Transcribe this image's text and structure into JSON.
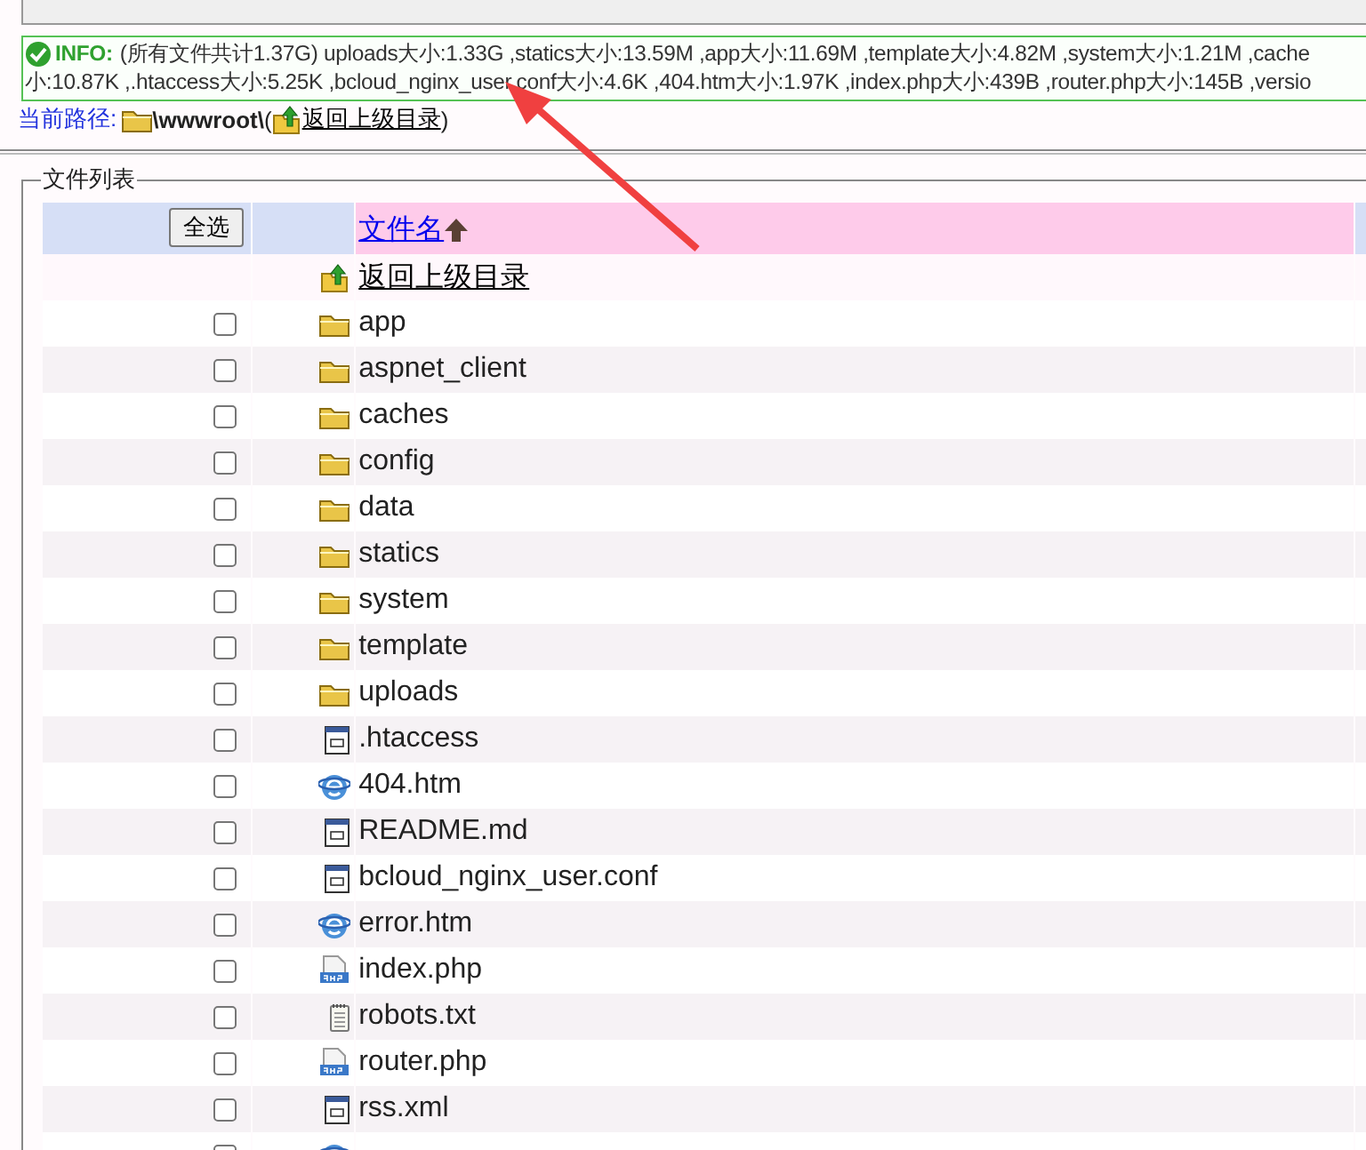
{
  "info": {
    "label": "INFO:",
    "lines": [
      "(所有文件共计1.37G) uploads大小:1.33G ,statics大小:13.59M ,app大小:11.69M ,template大小:4.82M ,system大小:1.21M ,cache",
      "小:10.87K ,.htaccess大小:5.25K ,bcloud_nginx_user.conf大小:4.6K ,404.htm大小:1.97K ,index.php大小:439B ,router.php大小:145B ,versio"
    ]
  },
  "path": {
    "label": "当前路径:",
    "current": "\\wwwroot\\",
    "open_paren": "(",
    "up_link": "返回上级目录",
    "close_paren": ")"
  },
  "file_list": {
    "legend": "文件列表",
    "select_all": "全选",
    "name_column": "文件名",
    "parent_link": "返回上级目录",
    "rows": [
      {
        "kind": "folder",
        "name": "app",
        "checked": false
      },
      {
        "kind": "folder",
        "name": "aspnet_client",
        "checked": false
      },
      {
        "kind": "folder",
        "name": "caches",
        "checked": false
      },
      {
        "kind": "folder",
        "name": "config",
        "checked": false
      },
      {
        "kind": "folder",
        "name": "data",
        "checked": false
      },
      {
        "kind": "folder",
        "name": "statics",
        "checked": false
      },
      {
        "kind": "folder",
        "name": "system",
        "checked": false
      },
      {
        "kind": "folder",
        "name": "template",
        "checked": false
      },
      {
        "kind": "folder",
        "name": "uploads",
        "checked": false
      },
      {
        "kind": "code",
        "name": ".htaccess",
        "checked": false
      },
      {
        "kind": "web",
        "name": "404.htm",
        "checked": false
      },
      {
        "kind": "code",
        "name": "README.md",
        "checked": false
      },
      {
        "kind": "code",
        "name": "bcloud_nginx_user.conf",
        "checked": false
      },
      {
        "kind": "web",
        "name": "error.htm",
        "checked": false
      },
      {
        "kind": "php",
        "name": "index.php",
        "checked": false
      },
      {
        "kind": "text",
        "name": "robots.txt",
        "checked": false
      },
      {
        "kind": "php",
        "name": "router.php",
        "checked": false
      },
      {
        "kind": "code",
        "name": "rss.xml",
        "checked": false
      },
      {
        "kind": "web",
        "checked": false
      }
    ]
  }
}
